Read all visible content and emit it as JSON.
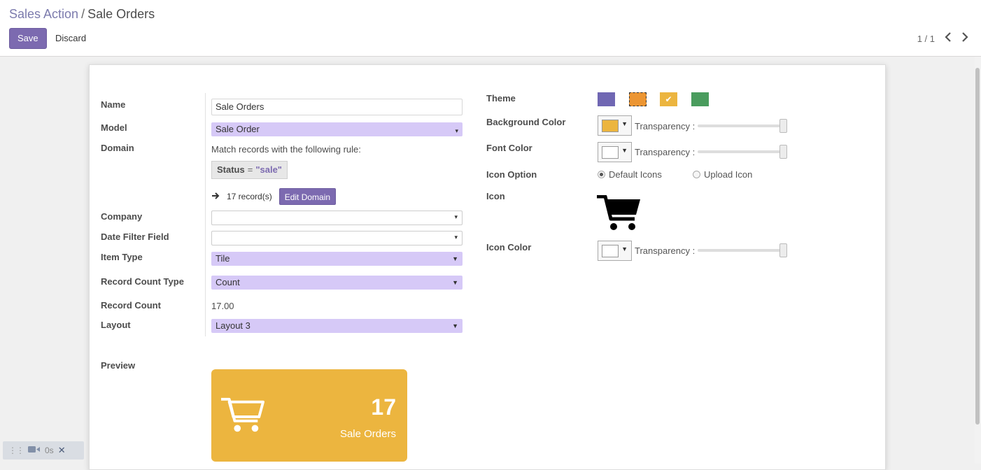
{
  "breadcrumb": {
    "parent": "Sales Action",
    "separator": "/",
    "current": "Sale Orders"
  },
  "buttons": {
    "save": "Save",
    "discard": "Discard",
    "edit_domain": "Edit Domain"
  },
  "pager": {
    "value": "1 / 1",
    "prev_icon": "chevron-left-icon",
    "next_icon": "chevron-right-icon"
  },
  "form": {
    "name": {
      "label": "Name",
      "value": "Sale Orders"
    },
    "model": {
      "label": "Model",
      "value": "Sale Order"
    },
    "domain": {
      "label": "Domain",
      "intro": "Match records with the following rule:",
      "rule_field": "Status",
      "rule_operator": "=",
      "rule_value": "\"sale\"",
      "records": "17 record(s)"
    },
    "company": {
      "label": "Company",
      "value": ""
    },
    "date_filter_field": {
      "label": "Date Filter Field",
      "value": ""
    },
    "item_type": {
      "label": "Item Type",
      "value": "Tile"
    },
    "record_count_type": {
      "label": "Record Count Type",
      "value": "Count"
    },
    "record_count": {
      "label": "Record Count",
      "value": "17.00"
    },
    "layout": {
      "label": "Layout",
      "value": "Layout 3"
    },
    "preview": {
      "label": "Preview"
    }
  },
  "appearance": {
    "theme": {
      "label": "Theme",
      "colors": [
        "#7067b3",
        "#ec9532",
        "#ecb53f",
        "#4a9c5e"
      ],
      "selected_index": 2,
      "check_glyph": "✔"
    },
    "background_color": {
      "label": "Background Color",
      "color": "#ecb53f",
      "transparency_label": "Transparency :"
    },
    "font_color": {
      "label": "Font Color",
      "color": "#ffffff",
      "transparency_label": "Transparency :"
    },
    "icon_option": {
      "label": "Icon Option",
      "options": [
        "Default Icons",
        "Upload Icon"
      ],
      "selected": "Default Icons"
    },
    "icon": {
      "label": "Icon",
      "name": "shopping-cart-icon"
    },
    "icon_color": {
      "label": "Icon Color",
      "color": "#ffffff",
      "transparency_label": "Transparency :"
    }
  },
  "preview_tile": {
    "count": "17",
    "name": "Sale Orders",
    "icon": "shopping-cart-icon",
    "background": "#ecb53f"
  },
  "recorder": {
    "time": "0s"
  }
}
